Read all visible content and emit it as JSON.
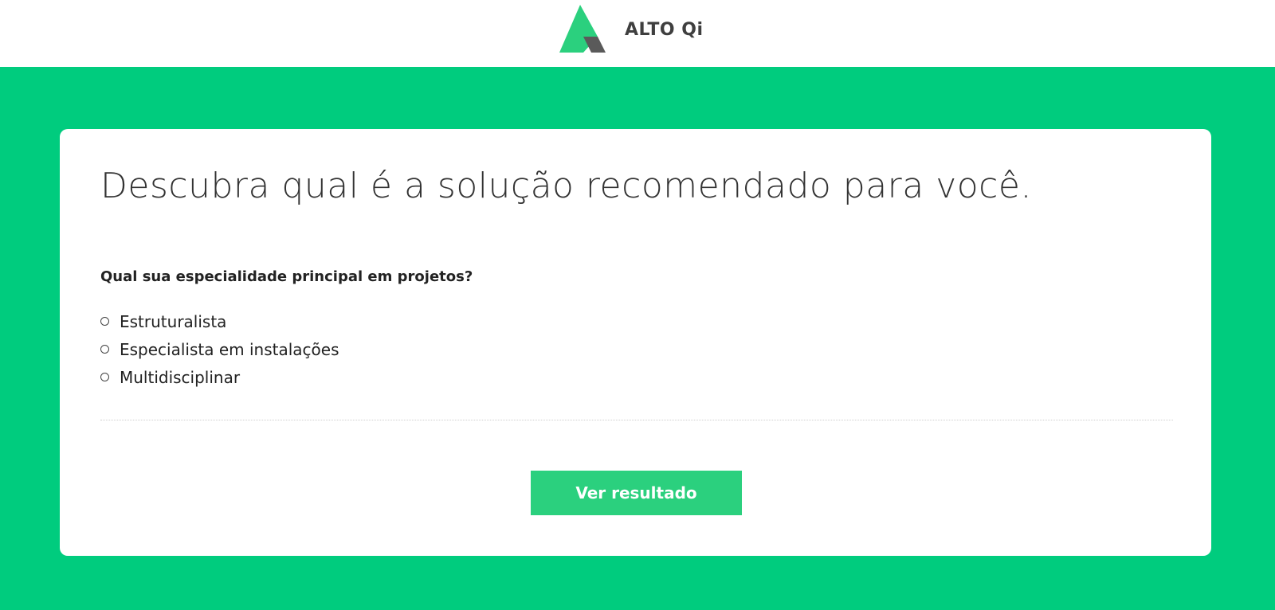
{
  "header": {
    "brand_name": "ALTO Qi",
    "logo_colors": {
      "green": "#2bd07e",
      "gray": "#5a5a5a"
    }
  },
  "hero": {
    "background_color": "#00cc7e"
  },
  "quiz": {
    "title": "Descubra qual é a solução recomendado para você.",
    "question": "Qual sua especialidade principal em projetos?",
    "options": [
      {
        "label": "Estruturalista",
        "selected": false
      },
      {
        "label": "Especialista em instalações",
        "selected": false
      },
      {
        "label": "Multidisciplinar",
        "selected": false
      }
    ],
    "submit_label": "Ver resultado",
    "submit_color": "#2bd07e"
  }
}
